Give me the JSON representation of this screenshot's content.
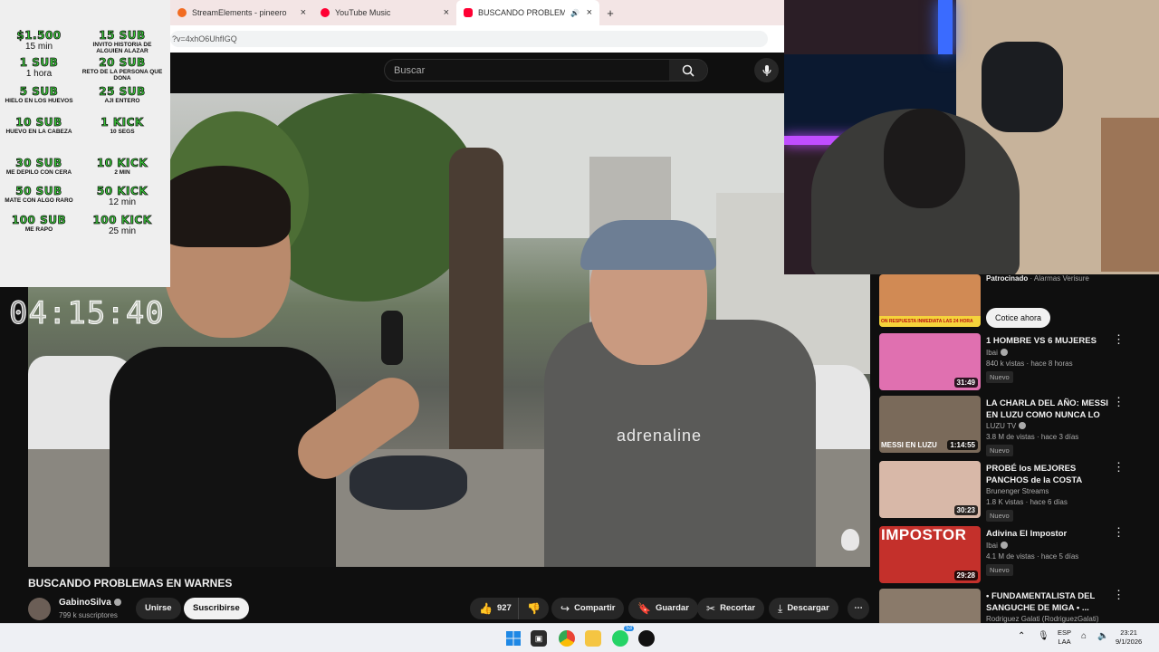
{
  "browser": {
    "tabs": [
      {
        "label": "StreamElements - pineero",
        "close": "×",
        "color": "#f26b21"
      },
      {
        "label": "YouTube Music",
        "close": "×",
        "color": "#ff0033"
      },
      {
        "label": "BUSCANDO PROBLEMAS E",
        "close": "×",
        "color": "#ff0033",
        "active": true
      }
    ],
    "new_tab": "+",
    "url": "?v=4xhO6UhfIGQ"
  },
  "youtube": {
    "search_placeholder": "Buscar",
    "video_title": "BUSCANDO PROBLEMAS EN WARNES",
    "video_print": "adrenaline",
    "channel": {
      "name": "GabinoSilva",
      "subs": "799 k suscriptores"
    },
    "buttons": {
      "join": "Unirse",
      "subscribe": "Suscribirse",
      "likes": "927",
      "share": "Compartir",
      "save": "Guardar",
      "clip": "Recortar",
      "download": "Descargar",
      "more": "⋯"
    }
  },
  "overlay": {
    "timer": "04:15:40",
    "goals": [
      {
        "title": "$1.500",
        "desc": "15 min",
        "small": false
      },
      {
        "title": "15 SUB",
        "desc": "INVITO HISTORIA DE ALGUIEN ALAZAR",
        "small": true
      },
      {
        "title": "1 SUB",
        "desc": "1 hora",
        "small": false
      },
      {
        "title": "20 SUB",
        "desc": "RETO DE LA PERSONA QUE DONA",
        "small": true
      },
      {
        "title": "5 SUB",
        "desc": "HIELO EN LOS HUEVOS",
        "small": true
      },
      {
        "title": "25 SUB",
        "desc": "AJI ENTERO",
        "small": true
      },
      {
        "title": "10 SUB",
        "desc": "HUEVO EN LA CABEZA",
        "small": true
      },
      {
        "title": "1 KICK",
        "desc": "10 SEGS",
        "small": true
      },
      {
        "title": "30 SUB",
        "desc": "ME DEPILO CON CERA",
        "small": true
      },
      {
        "title": "10 KICK",
        "desc": "2 MIN",
        "small": true
      },
      {
        "title": "50 SUB",
        "desc": "MATE CON ALGO RARO",
        "small": true
      },
      {
        "title": "50 KICK",
        "desc": "12 min",
        "small": false
      },
      {
        "title": "100 SUB",
        "desc": "ME RAPO",
        "small": true
      },
      {
        "title": "100 KICK",
        "desc": "25 min",
        "small": false
      }
    ]
  },
  "sidebar": {
    "sponsored": {
      "label": "Patrocinado",
      "advertiser": "Alarmas Verisure",
      "cta": "Cotice ahora",
      "thumb_text": "ON RESPUESTA INMEDIATA LAS 24 HORA"
    },
    "videos": [
      {
        "title": "1 HOMBRE VS 6 MUJERES",
        "channel": "Ibai",
        "views": "840 k vistas · hace 8 horas",
        "badge": "Nuevo",
        "duration": "31:49",
        "color": "#e070b0",
        "thumb_text": ""
      },
      {
        "title": "LA CHARLA DEL AÑO: MESSI EN LUZU COMO NUNCA LO ...",
        "channel": "LUZU TV",
        "views": "3.8 M de vistas · hace 3 días",
        "badge": "Nuevo",
        "duration": "1:14:55",
        "color": "#7a6a5a",
        "thumb_text": "MESSI EN LUZU"
      },
      {
        "title": "PROBÉ los MEJORES PANCHOS de la COSTA ARGENTINA",
        "channel": "Brunenger Streams",
        "views": "1.8 K vistas · hace 6 días",
        "badge": "Nuevo",
        "duration": "30:23",
        "color": "#d8b8a8",
        "thumb_text": ""
      },
      {
        "title": "Adivina El Impostor",
        "channel": "Ibai",
        "views": "4.1 M de vistas · hace 5 días",
        "badge": "Nuevo",
        "duration": "29:28",
        "color": "#c4302b",
        "thumb_text": "IMPOSTOR"
      },
      {
        "title": "• FUNDAMENTALISTA DEL SANGUCHE DE MIGA • ...",
        "channel": "Rodriguez Galati (RodriguezGalati)",
        "views": "",
        "badge": "",
        "duration": "",
        "color": "#8a7a6a",
        "thumb_text": ""
      }
    ],
    "more_icon": "⋮"
  },
  "taskbar": {
    "lang": "ESP",
    "layout": "LAA",
    "time": "23:21",
    "date": "9/1/2026",
    "whatsapp_count": "53"
  }
}
